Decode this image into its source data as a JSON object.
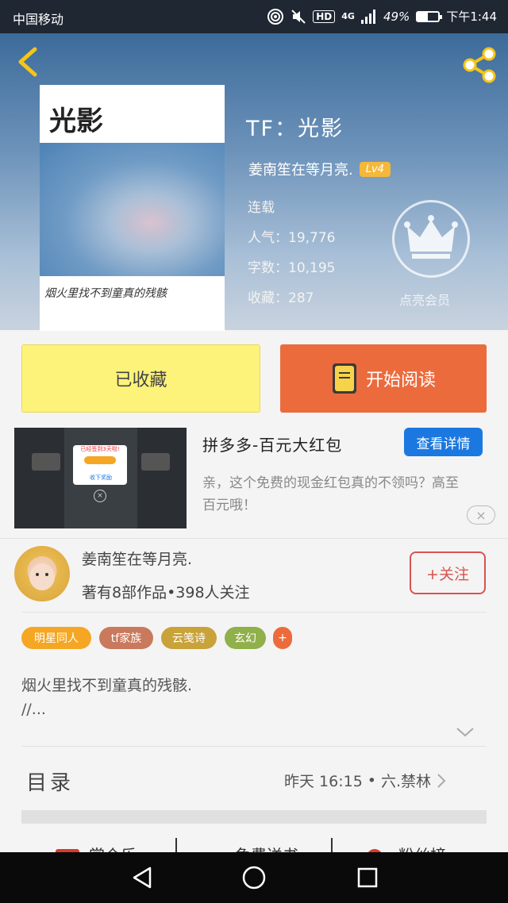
{
  "status_bar": {
    "carrier": "中国移动",
    "hd": "HD",
    "network": "4G",
    "battery": "49%",
    "time": "下午1:44",
    "battery_level": 0.49
  },
  "header": {
    "cover": {
      "title": "光影",
      "caption": "烟火里找不到童真的残骸"
    },
    "book_title": "TF：光影",
    "author": "姜南笙在等月亮.",
    "level": "Lv4",
    "status": "连载",
    "popularity": "人气：19,776",
    "word_count": "字数：10,195",
    "favorites": "收藏：287",
    "vip_label": "点亮会员"
  },
  "actions": {
    "favorited_label": "已收藏",
    "read_label": "开始阅读"
  },
  "ad": {
    "image_badge": "已经签到3天啦!",
    "image_button": "收下奖励",
    "title": "拼多多-百元大红包",
    "button": "查看详情",
    "description": "亲，这个免费的现金红包真的不领吗？高至百元哦！"
  },
  "author_card": {
    "name": "姜南笙在等月亮.",
    "stats": "著有8部作品•398人关注",
    "follow": "+关注"
  },
  "tags": [
    {
      "label": "明星同人",
      "color": "#f5a623"
    },
    {
      "label": "tf家族",
      "color": "#c97a5c"
    },
    {
      "label": "云笺诗",
      "color": "#c9a23a"
    },
    {
      "label": "玄幻",
      "color": "#8fb04a"
    },
    {
      "label": "+",
      "color": "#ec6b3d"
    }
  ],
  "intro": {
    "line1": "烟火里找不到童真的残骸.",
    "line2": "//..."
  },
  "catalog": {
    "label": "目录",
    "updated": "昨天 16:15",
    "chapter": "六.禁林"
  },
  "bottom_tabs": [
    "赏个乐",
    "免费送书",
    "粉丝榜"
  ]
}
